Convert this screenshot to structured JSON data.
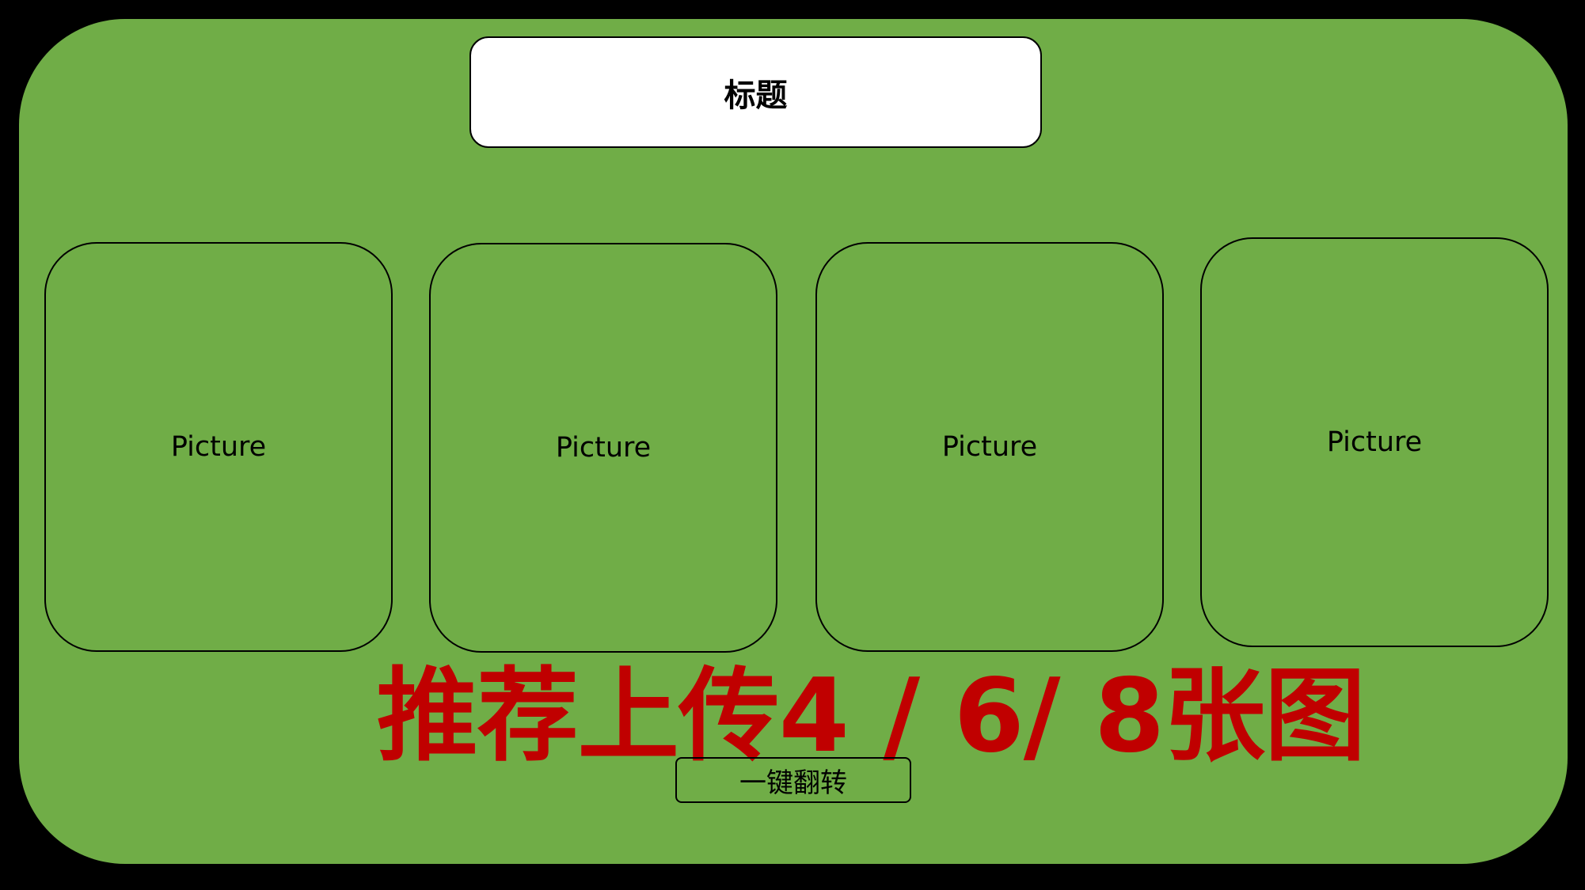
{
  "colors": {
    "background": "#000000",
    "panel": "#70ad47",
    "title_box": "#ffffff",
    "notice": "#c00000",
    "border": "#000000"
  },
  "header": {
    "title": "标题"
  },
  "gallery": {
    "cards": [
      {
        "label": "Picture"
      },
      {
        "label": "Picture"
      },
      {
        "label": "Picture"
      },
      {
        "label": "Picture"
      }
    ]
  },
  "notice": {
    "text": "推荐上传4 / 6/ 8张图"
  },
  "controls": {
    "flip_label": "一键翻转"
  }
}
